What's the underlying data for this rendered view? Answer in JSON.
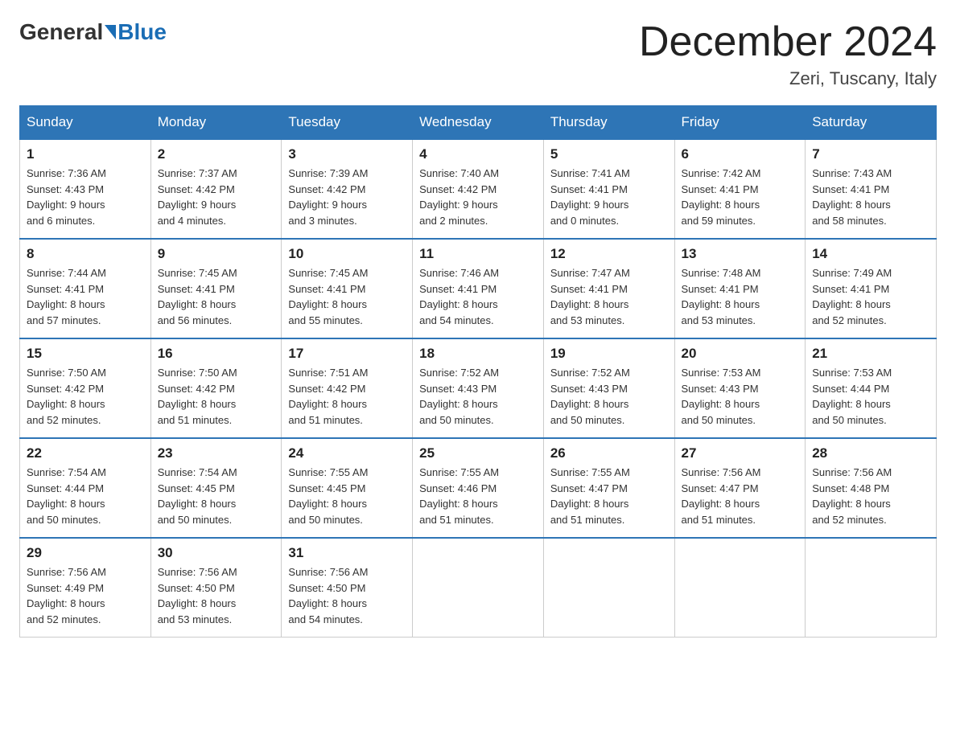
{
  "logo": {
    "general": "General",
    "arrow": "▶",
    "blue": "Blue"
  },
  "header": {
    "title": "December 2024",
    "location": "Zeri, Tuscany, Italy"
  },
  "weekdays": [
    "Sunday",
    "Monday",
    "Tuesday",
    "Wednesday",
    "Thursday",
    "Friday",
    "Saturday"
  ],
  "weeks": [
    [
      {
        "day": "1",
        "sunrise": "7:36 AM",
        "sunset": "4:43 PM",
        "daylight": "9 hours and 6 minutes."
      },
      {
        "day": "2",
        "sunrise": "7:37 AM",
        "sunset": "4:42 PM",
        "daylight": "9 hours and 4 minutes."
      },
      {
        "day": "3",
        "sunrise": "7:39 AM",
        "sunset": "4:42 PM",
        "daylight": "9 hours and 3 minutes."
      },
      {
        "day": "4",
        "sunrise": "7:40 AM",
        "sunset": "4:42 PM",
        "daylight": "9 hours and 2 minutes."
      },
      {
        "day": "5",
        "sunrise": "7:41 AM",
        "sunset": "4:41 PM",
        "daylight": "9 hours and 0 minutes."
      },
      {
        "day": "6",
        "sunrise": "7:42 AM",
        "sunset": "4:41 PM",
        "daylight": "8 hours and 59 minutes."
      },
      {
        "day": "7",
        "sunrise": "7:43 AM",
        "sunset": "4:41 PM",
        "daylight": "8 hours and 58 minutes."
      }
    ],
    [
      {
        "day": "8",
        "sunrise": "7:44 AM",
        "sunset": "4:41 PM",
        "daylight": "8 hours and 57 minutes."
      },
      {
        "day": "9",
        "sunrise": "7:45 AM",
        "sunset": "4:41 PM",
        "daylight": "8 hours and 56 minutes."
      },
      {
        "day": "10",
        "sunrise": "7:45 AM",
        "sunset": "4:41 PM",
        "daylight": "8 hours and 55 minutes."
      },
      {
        "day": "11",
        "sunrise": "7:46 AM",
        "sunset": "4:41 PM",
        "daylight": "8 hours and 54 minutes."
      },
      {
        "day": "12",
        "sunrise": "7:47 AM",
        "sunset": "4:41 PM",
        "daylight": "8 hours and 53 minutes."
      },
      {
        "day": "13",
        "sunrise": "7:48 AM",
        "sunset": "4:41 PM",
        "daylight": "8 hours and 53 minutes."
      },
      {
        "day": "14",
        "sunrise": "7:49 AM",
        "sunset": "4:41 PM",
        "daylight": "8 hours and 52 minutes."
      }
    ],
    [
      {
        "day": "15",
        "sunrise": "7:50 AM",
        "sunset": "4:42 PM",
        "daylight": "8 hours and 52 minutes."
      },
      {
        "day": "16",
        "sunrise": "7:50 AM",
        "sunset": "4:42 PM",
        "daylight": "8 hours and 51 minutes."
      },
      {
        "day": "17",
        "sunrise": "7:51 AM",
        "sunset": "4:42 PM",
        "daylight": "8 hours and 51 minutes."
      },
      {
        "day": "18",
        "sunrise": "7:52 AM",
        "sunset": "4:43 PM",
        "daylight": "8 hours and 50 minutes."
      },
      {
        "day": "19",
        "sunrise": "7:52 AM",
        "sunset": "4:43 PM",
        "daylight": "8 hours and 50 minutes."
      },
      {
        "day": "20",
        "sunrise": "7:53 AM",
        "sunset": "4:43 PM",
        "daylight": "8 hours and 50 minutes."
      },
      {
        "day": "21",
        "sunrise": "7:53 AM",
        "sunset": "4:44 PM",
        "daylight": "8 hours and 50 minutes."
      }
    ],
    [
      {
        "day": "22",
        "sunrise": "7:54 AM",
        "sunset": "4:44 PM",
        "daylight": "8 hours and 50 minutes."
      },
      {
        "day": "23",
        "sunrise": "7:54 AM",
        "sunset": "4:45 PM",
        "daylight": "8 hours and 50 minutes."
      },
      {
        "day": "24",
        "sunrise": "7:55 AM",
        "sunset": "4:45 PM",
        "daylight": "8 hours and 50 minutes."
      },
      {
        "day": "25",
        "sunrise": "7:55 AM",
        "sunset": "4:46 PM",
        "daylight": "8 hours and 51 minutes."
      },
      {
        "day": "26",
        "sunrise": "7:55 AM",
        "sunset": "4:47 PM",
        "daylight": "8 hours and 51 minutes."
      },
      {
        "day": "27",
        "sunrise": "7:56 AM",
        "sunset": "4:47 PM",
        "daylight": "8 hours and 51 minutes."
      },
      {
        "day": "28",
        "sunrise": "7:56 AM",
        "sunset": "4:48 PM",
        "daylight": "8 hours and 52 minutes."
      }
    ],
    [
      {
        "day": "29",
        "sunrise": "7:56 AM",
        "sunset": "4:49 PM",
        "daylight": "8 hours and 52 minutes."
      },
      {
        "day": "30",
        "sunrise": "7:56 AM",
        "sunset": "4:50 PM",
        "daylight": "8 hours and 53 minutes."
      },
      {
        "day": "31",
        "sunrise": "7:56 AM",
        "sunset": "4:50 PM",
        "daylight": "8 hours and 54 minutes."
      },
      null,
      null,
      null,
      null
    ]
  ],
  "labels": {
    "sunrise": "Sunrise:",
    "sunset": "Sunset:",
    "daylight": "Daylight:"
  }
}
